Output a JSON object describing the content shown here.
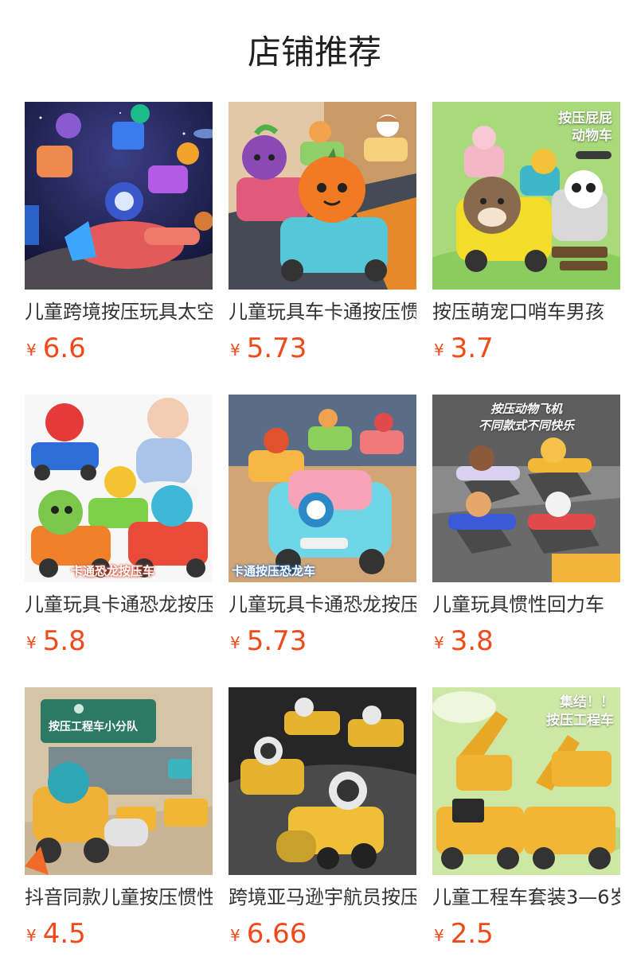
{
  "page": {
    "title": "店铺推荐"
  },
  "currency_symbol": "¥",
  "colors": {
    "price": "#f04a1a",
    "title_text": "#333333",
    "heading_text": "#1f1f1f"
  },
  "products": [
    {
      "title": "儿童跨境按压玩具太空",
      "price": "6.6",
      "image_icon": "space-toy-planes-icon",
      "thumb_bg": "space-night"
    },
    {
      "title": "儿童玩具车卡通按压惯",
      "price": "5.73",
      "image_icon": "fruit-cars-icon",
      "thumb_bg": "road-cars"
    },
    {
      "title": "按压萌宠口哨车男孩",
      "price": "3.7",
      "image_icon": "pet-cars-icon",
      "thumb_bg": "green-pets",
      "overlay_text": "按压屁屁\n动物车"
    },
    {
      "title": "儿童玩具卡通恐龙按压",
      "price": "5.8",
      "image_icon": "dinosaur-cars-icon",
      "thumb_bg": "white-baby",
      "overlay_text": "卡通恐龙按压车"
    },
    {
      "title": "儿童玩具卡通恐龙按压",
      "price": "5.73",
      "image_icon": "dinosaur-cars-blue-icon",
      "thumb_bg": "wood-floor",
      "overlay_text": "卡通按压恐龙车"
    },
    {
      "title": "儿童玩具惯性回力车",
      "price": "3.8",
      "image_icon": "animal-planes-icon",
      "thumb_bg": "grey-planes",
      "overlay_text": "按压动物飞机\n不同款式不同快乐"
    },
    {
      "title": "抖音同款儿童按压惯性",
      "price": "4.5",
      "image_icon": "engineering-trucks-icon",
      "thumb_bg": "beige-engineering",
      "overlay_text": "按压工程车小分队"
    },
    {
      "title": "跨境亚马逊宇航员按压",
      "price": "6.66",
      "image_icon": "astronaut-trucks-icon",
      "thumb_bg": "dark-astronaut"
    },
    {
      "title": "儿童工程车套装3—6岁",
      "price": "2.5",
      "image_icon": "excavator-set-icon",
      "thumb_bg": "green-excavator",
      "overlay_text": "集结！！\n按压工程车"
    }
  ]
}
